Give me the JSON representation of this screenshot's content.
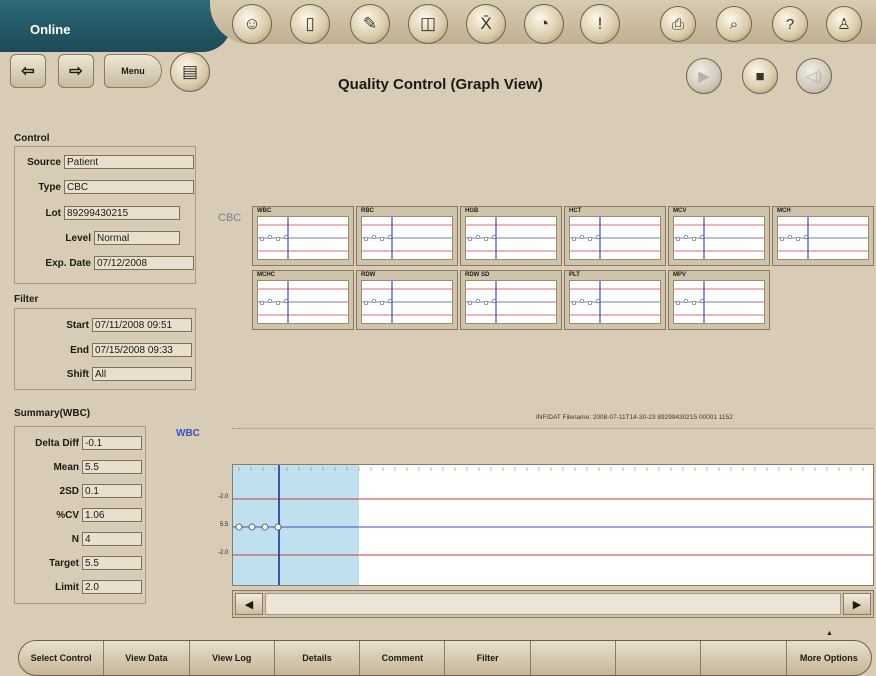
{
  "header": {
    "status": "Online",
    "title": "Quality Control (Graph View)",
    "menu_label": "Menu"
  },
  "control": {
    "section_title": "Control",
    "fields": [
      {
        "label": "Source",
        "value": "Patient"
      },
      {
        "label": "Type",
        "value": "CBC"
      },
      {
        "label": "Lot",
        "value": "89299430215"
      },
      {
        "label": "Level",
        "value": "Normal"
      },
      {
        "label": "Exp. Date",
        "value": "07/12/2008"
      }
    ]
  },
  "filter": {
    "section_title": "Filter",
    "fields": [
      {
        "label": "Start",
        "value": "07/11/2008 09:51"
      },
      {
        "label": "End",
        "value": "07/15/2008 09:33"
      },
      {
        "label": "Shift",
        "value": "All"
      }
    ]
  },
  "summary": {
    "section_title": "Summary(WBC)",
    "fields": [
      {
        "label": "Delta Diff",
        "value": "-0.1"
      },
      {
        "label": "Mean",
        "value": "5.5"
      },
      {
        "label": "2SD",
        "value": "0.1"
      },
      {
        "label": "%CV",
        "value": "1.06"
      },
      {
        "label": "N",
        "value": "4"
      },
      {
        "label": "Target",
        "value": "5.5"
      },
      {
        "label": "Limit",
        "value": "2.0"
      }
    ]
  },
  "graph": {
    "group_label": "CBC",
    "thumbnails": [
      "WBC",
      "RBC",
      "HGB",
      "HCT",
      "MCV",
      "MCH",
      "MCHC",
      "RDW",
      "RDW SD",
      "PLT",
      "MPV"
    ],
    "main_label": "WBC",
    "file_info": "INF/DAT Filename: 2008-07-11T14-30-23 89299430215 00001 1152",
    "axis_labels": {
      "upper": "-2.0",
      "center": "5.5",
      "lower": "-2.0"
    }
  },
  "toolbar": {
    "buttons": [
      "Select Control",
      "View Data",
      "View Log",
      "Details",
      "Comment",
      "Filter",
      "",
      "",
      "",
      "More Options"
    ]
  },
  "colors": {
    "accent": "#2e6a78",
    "target_line": "#3b4fc2",
    "limit_line": "#d03b3b",
    "selection": "#bfe0ee"
  }
}
